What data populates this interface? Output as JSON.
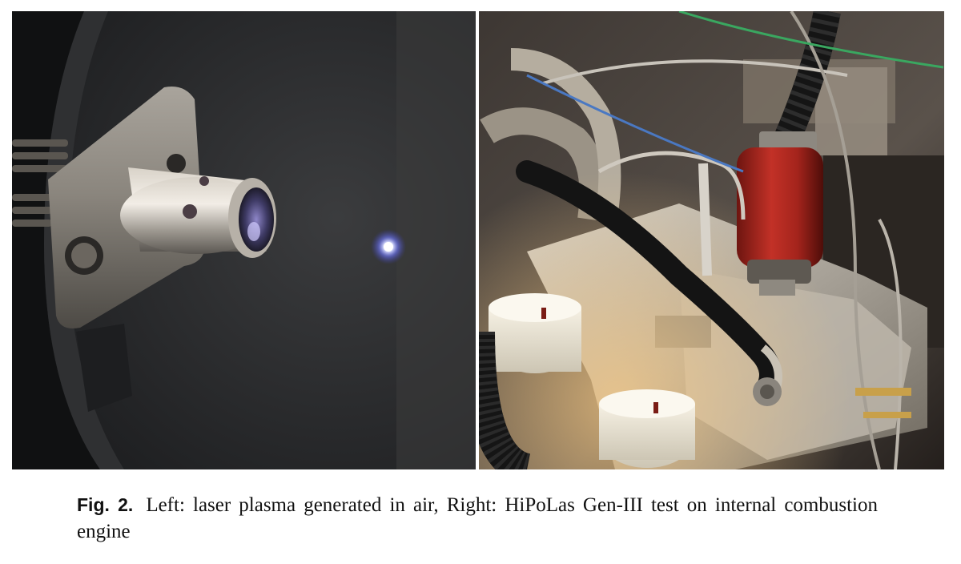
{
  "figure": {
    "label": "Fig. 2.",
    "caption": "Left:  laser plasma generated in air, Right:  HiPoLas Gen-III test on internal combustion engine"
  },
  "panels": [
    {
      "id": "left",
      "image": "laser-spark-plug-with-plasma-in-air"
    },
    {
      "id": "right",
      "image": "engine-test-with-red-laser-igniter"
    }
  ]
}
